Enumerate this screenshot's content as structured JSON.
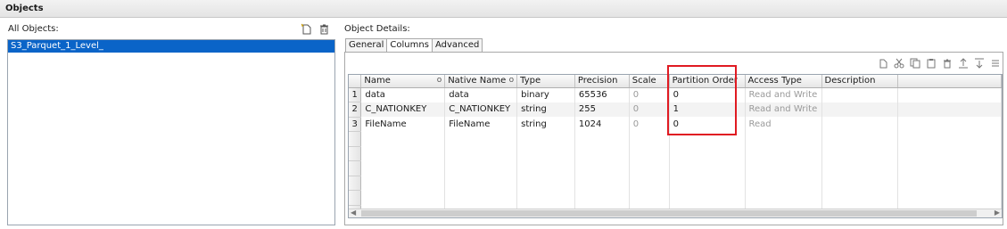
{
  "header": {
    "title": "Objects"
  },
  "left_panel": {
    "title": "All Objects:",
    "objects": [
      "S3_Parquet_1_Level_"
    ]
  },
  "right_panel": {
    "title": "Object Details:",
    "tabs": [
      {
        "label": "General",
        "active": false
      },
      {
        "label": "Columns",
        "active": true
      },
      {
        "label": "Advanced",
        "active": false
      }
    ]
  },
  "grid": {
    "columns": [
      "Name",
      "Native Name",
      "Type",
      "Precision",
      "Scale",
      "Partition Order",
      "Access Type",
      "Description"
    ],
    "sort_marker": "o",
    "rows": [
      {
        "num": "1",
        "name": "data",
        "native_name": "data",
        "type": "binary",
        "precision": "65536",
        "scale": "0",
        "partition_order": "0",
        "access_type": "Read and Write",
        "description": ""
      },
      {
        "num": "2",
        "name": "C_NATIONKEY",
        "native_name": "C_NATIONKEY",
        "type": "string",
        "precision": "255",
        "scale": "0",
        "partition_order": "1",
        "access_type": "Read and Write",
        "description": ""
      },
      {
        "num": "3",
        "name": "FileName",
        "native_name": "FileName",
        "type": "string",
        "precision": "1024",
        "scale": "0",
        "partition_order": "0",
        "access_type": "Read",
        "description": ""
      }
    ]
  },
  "colors": {
    "selection": "#0a64c8",
    "highlight_box": "#e01a22"
  }
}
